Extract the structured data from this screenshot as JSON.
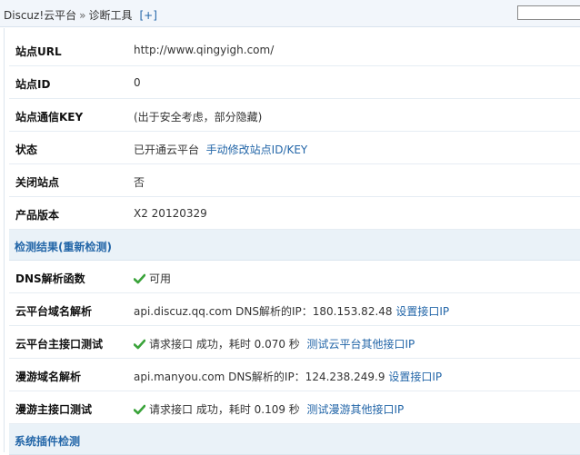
{
  "header": {
    "crumb_root": "Discuz!云平台",
    "crumb_sep": "»",
    "crumb_current": "诊断工具",
    "add_link": "[+]"
  },
  "site_info": [
    {
      "label": "站点URL",
      "value": "http://www.qingyigh.com/"
    },
    {
      "label": "站点ID",
      "value": "0"
    },
    {
      "label": "站点通信KEY",
      "value": "(出于安全考虑，部分隐藏)"
    },
    {
      "label": "状态",
      "value": "已开通云平台",
      "link": "手动修改站点ID/KEY"
    },
    {
      "label": "关闭站点",
      "value": "否"
    },
    {
      "label": "产品版本",
      "value": "X2 20120329"
    }
  ],
  "section_check": {
    "title": "检测结果(重新检测)"
  },
  "checks": [
    {
      "label": "DNS解析函数",
      "value": "可用"
    },
    {
      "label": "云平台域名解析",
      "value": "api.discuz.qq.com DNS解析的IP：180.153.82.48",
      "link": "设置接口IP"
    },
    {
      "label": "云平台主接口测试",
      "value": "请求接口 成功，耗时 0.070 秒",
      "link": "测试云平台其他接口IP"
    },
    {
      "label": "漫游域名解析",
      "value": "api.manyou.com DNS解析的IP：124.238.249.9",
      "link": "设置接口IP"
    },
    {
      "label": "漫游主接口测试",
      "value": "请求接口 成功，耗时 0.109 秒",
      "link": "测试漫游其他接口IP"
    }
  ],
  "section_plugins": {
    "title": "系统插件检测"
  },
  "colors": {
    "link": "#2366a8",
    "section_bg": "#eaf2f8",
    "check_green": "#3aa33a"
  }
}
